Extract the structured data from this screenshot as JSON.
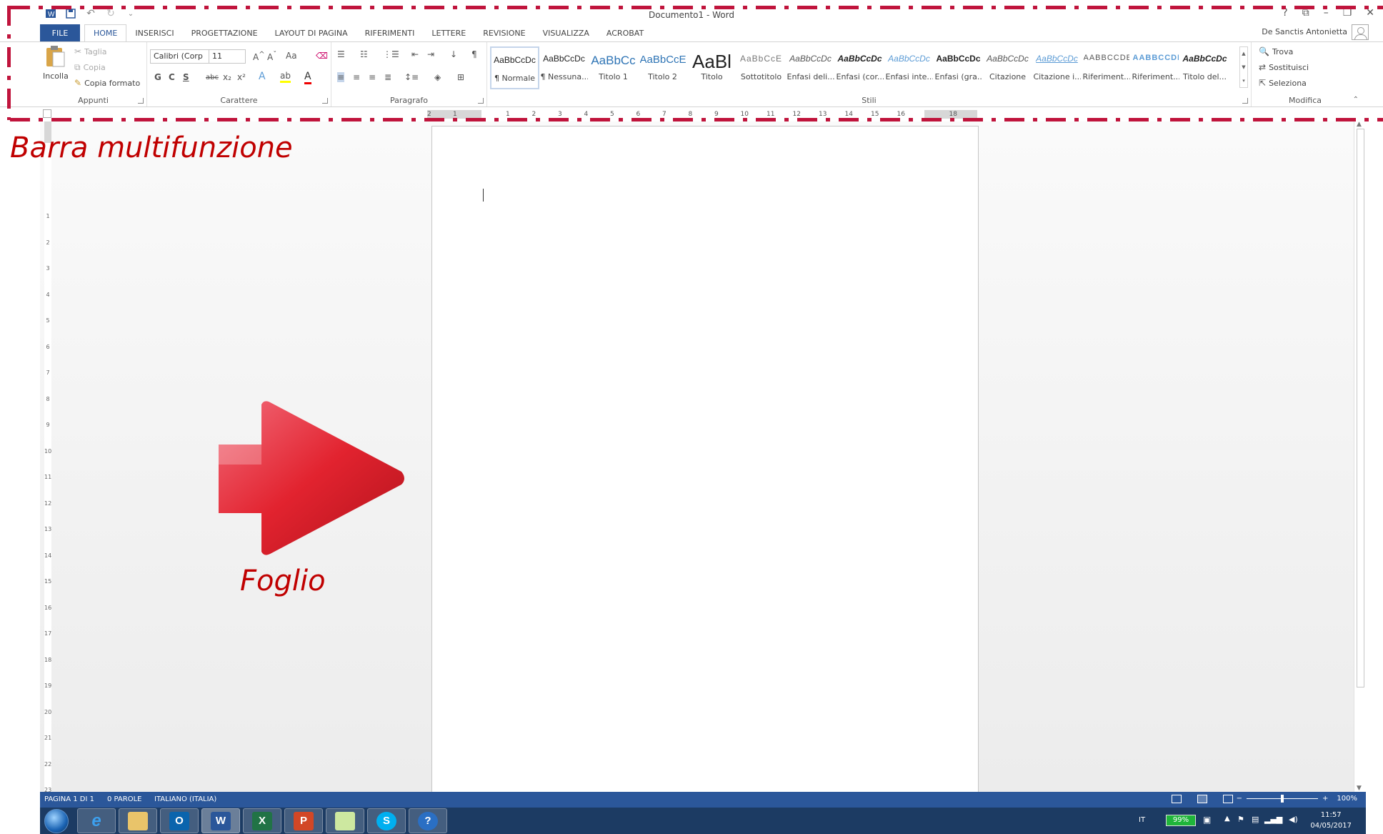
{
  "window": {
    "title": "Documento1 - Word",
    "help": "?",
    "controls": [
      "?",
      "⧉",
      "–",
      "❐",
      "✕"
    ]
  },
  "tabs": {
    "file": "FILE",
    "items": [
      "HOME",
      "INSERISCI",
      "PROGETTAZIONE",
      "LAYOUT DI PAGINA",
      "RIFERIMENTI",
      "LETTERE",
      "REVISIONE",
      "VISUALIZZA",
      "ACROBAT"
    ],
    "active": "HOME"
  },
  "user": {
    "name": "De Sanctis Antonietta"
  },
  "ribbon": {
    "clipboard": {
      "label": "Appunti",
      "paste": "Incolla",
      "cut": "Taglia",
      "copy": "Copia",
      "format_painter": "Copia formato"
    },
    "font": {
      "label": "Carattere",
      "font_name": "Calibri (Corp",
      "font_size": "11",
      "aa": "Aa",
      "bold": "G",
      "italic": "C",
      "underline": "S",
      "strike": "abc",
      "sub": "x₂",
      "sup": "x²"
    },
    "paragraph": {
      "label": "Paragrafo"
    },
    "styles": {
      "label": "Stili",
      "items": [
        {
          "preview": "AaBbCcDc",
          "name": "¶ Normale"
        },
        {
          "preview": "AaBbCcDc",
          "name": "¶ Nessuna..."
        },
        {
          "preview": "AaBbCc",
          "name": "Titolo 1"
        },
        {
          "preview": "AaBbCcE",
          "name": "Titolo 2"
        },
        {
          "preview": "AaBl",
          "name": "Titolo"
        },
        {
          "preview": "AaBbCcE",
          "name": "Sottotitolo"
        },
        {
          "preview": "AaBbCcDc",
          "name": "Enfasi deli..."
        },
        {
          "preview": "AaBbCcDc",
          "name": "Enfasi (cor..."
        },
        {
          "preview": "AaBbCcDc",
          "name": "Enfasi inte..."
        },
        {
          "preview": "AaBbCcDc",
          "name": "Enfasi (gra..."
        },
        {
          "preview": "AaBbCcDc",
          "name": "Citazione"
        },
        {
          "preview": "AaBbCcDc",
          "name": "Citazione i..."
        },
        {
          "preview": "AABBCCDE",
          "name": "Riferiment..."
        },
        {
          "preview": "AABBCCDE",
          "name": "Riferiment..."
        },
        {
          "preview": "AaBbCcDc",
          "name": "Titolo del..."
        }
      ]
    },
    "editing": {
      "label": "Modifica",
      "find": "Trova",
      "replace": "Sostituisci",
      "select": "Seleziona"
    }
  },
  "ruler": {
    "ticks": [
      "2",
      "1",
      "1",
      "2",
      "3",
      "4",
      "5",
      "6",
      "7",
      "8",
      "9",
      "10",
      "11",
      "12",
      "13",
      "14",
      "15",
      "16",
      "18"
    ],
    "vticks": [
      "1",
      "2",
      "3",
      "4",
      "5",
      "6",
      "7",
      "8",
      "9",
      "10",
      "11",
      "12",
      "13",
      "14",
      "15",
      "16",
      "17",
      "18",
      "19",
      "20",
      "21",
      "22",
      "23"
    ]
  },
  "status": {
    "page": "PAGINA 1 DI 1",
    "words": "0 PAROLE",
    "language": "ITALIANO (ITALIA)",
    "zoom": "100%",
    "zoom_percent": 50
  },
  "taskbar": {
    "apps": [
      "Internet Explorer",
      "Esplora risorse",
      "Outlook",
      "Word",
      "Excel",
      "PowerPoint",
      "Cartella",
      "Skype",
      "Guida"
    ],
    "lang": "IT",
    "battery": "99%",
    "time": "11:57",
    "date": "04/05/2017"
  },
  "annotations": {
    "ribbon_label": "Barra multifunzione",
    "sheet_label": "Foglio"
  },
  "colors": {
    "word_blue": "#2b579a",
    "annotation_red": "#c00000",
    "dash_red": "#c0143c"
  }
}
